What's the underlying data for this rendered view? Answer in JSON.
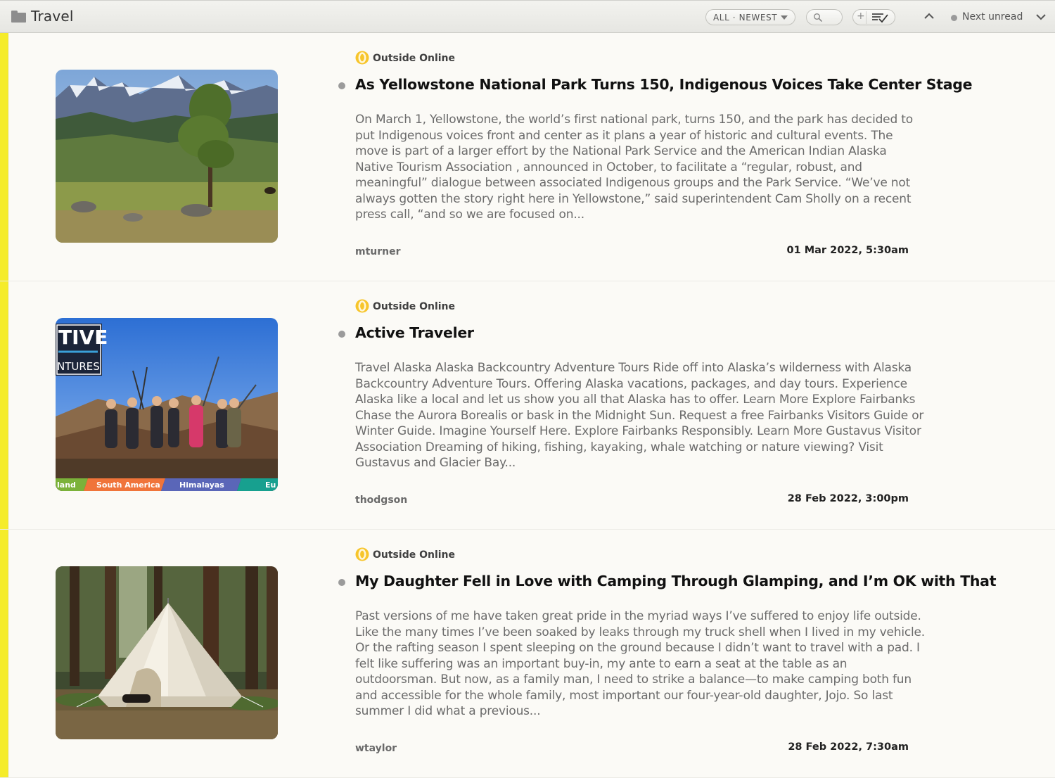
{
  "header": {
    "feed_title": "Travel",
    "filter_label": "ALL · NEWEST",
    "mark_read_plus": "+",
    "next_unread_label": "Next unread"
  },
  "colors": {
    "unread_bar": "#f5ec2a",
    "favicon": "#f7c52b",
    "unread_dot": "#9b9b9b"
  },
  "stories": [
    {
      "source": "Outside Online",
      "title": "As Yellowstone National Park Turns 150, Indigenous Voices Take Center Stage",
      "excerpt": "On March 1, Yellowstone, the world’s first national park, turns 150, and the park has decided to put Indigenous voices front and center as it plans a year of historic and cultural events. The move is part of a larger effort by the National Park Service and the American Indian Alaska Native Tourism Association , announced in October, to facilitate a “regular, robust, and meaningful” dialogue between associated Indigenous groups and the Park Service. “We’ve not always gotten the story right here in Yellowstone,” said superintendent Cam Sholly on a recent press call, “and so we are focused on...",
      "author": "mturner",
      "date": "01 Mar 2022, 5:30am",
      "image": "mountain-meadow-tree"
    },
    {
      "source": "Outside Online",
      "title": "Active Traveler",
      "excerpt": "Travel Alaska Alaska Backcountry Adventure Tours Ride off into Alaska’s wilderness with Alaska Backcountry Adventure Tours. Offering Alaska vacations, packages, and day tours. Experience Alaska like a local and let us show you all that Alaska has to offer. Learn More Explore Fairbanks Chase the Aurora Borealis or bask in the Midnight Sun. Request a free Fairbanks Visitors Guide or Winter Guide. Imagine Yourself Here. Explore Fairbanks Responsibly. Learn More Gustavus Visitor Association Dreaming of hiking, fishing, kayaking, whale watching or nature viewing? Visit Gustavus and Glacier Bay...",
      "author": "thodgson",
      "date": "28 Feb 2022, 3:00pm",
      "image": "hikers-group",
      "image_text": {
        "logo_top": "TIVE",
        "logo_bottom": "NTURES",
        "band_1": "land",
        "band_2": "South America",
        "band_3": "Himalayas",
        "band_4": "Eu"
      }
    },
    {
      "source": "Outside Online",
      "title": "My Daughter Fell in Love with Camping Through Glamping, and I’m OK with That",
      "excerpt": "Past versions of me have taken great pride in the myriad ways I’ve suffered to enjoy life outside. Like the many times I’ve been soaked by leaks through my truck shell when I lived in my vehicle. Or the rafting season I spent sleeping on the ground because I didn’t want to travel with a pad. I felt like suffering was an important buy-in, my ante to earn a seat at the table as an outdoorsman. But now, as a family man, I need to strike a balance—to make camping both fun and accessible for the whole family, most important our four-year-old daughter, Jojo. So last summer I did what a previous...",
      "author": "wtaylor",
      "date": "28 Feb 2022, 7:30am",
      "image": "bell-tent-forest"
    }
  ]
}
